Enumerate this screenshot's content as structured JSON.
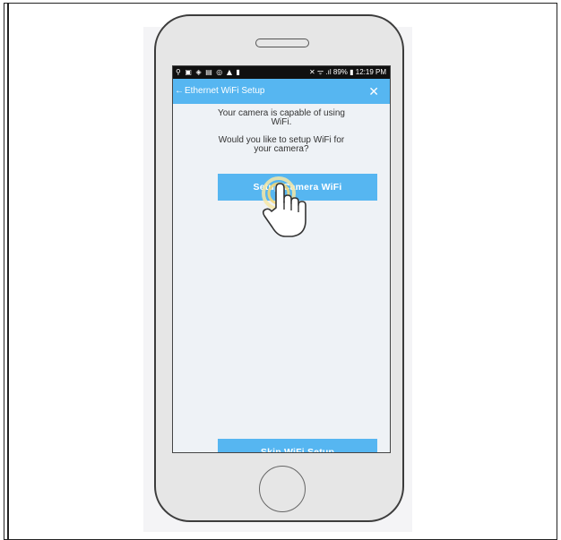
{
  "status_bar": {
    "icons_left": "⚲ ▣ ◈ ▤ ◎ ▲ ▮",
    "status_right": "✕ ᯤ .ıl 89% ▮ 12:19 PM"
  },
  "app_bar": {
    "back_glyph": "←",
    "title": "Ethernet WiFi Setup",
    "close_glyph": "✕"
  },
  "content": {
    "message_line1": "Your camera is capable of using",
    "message_line2": "WiFi.",
    "question_line1": "Would you like to setup WiFi for",
    "question_line2": "your camera?"
  },
  "buttons": {
    "setup_label": "Setup Camera WiFi",
    "skip_label": "Skip WiFi Setup"
  },
  "colors": {
    "accent": "#56b6f1",
    "screen_bg": "#eef2f6",
    "phone_body": "#e6e6e6"
  },
  "icons": {
    "hand": "touch-hand-icon"
  }
}
